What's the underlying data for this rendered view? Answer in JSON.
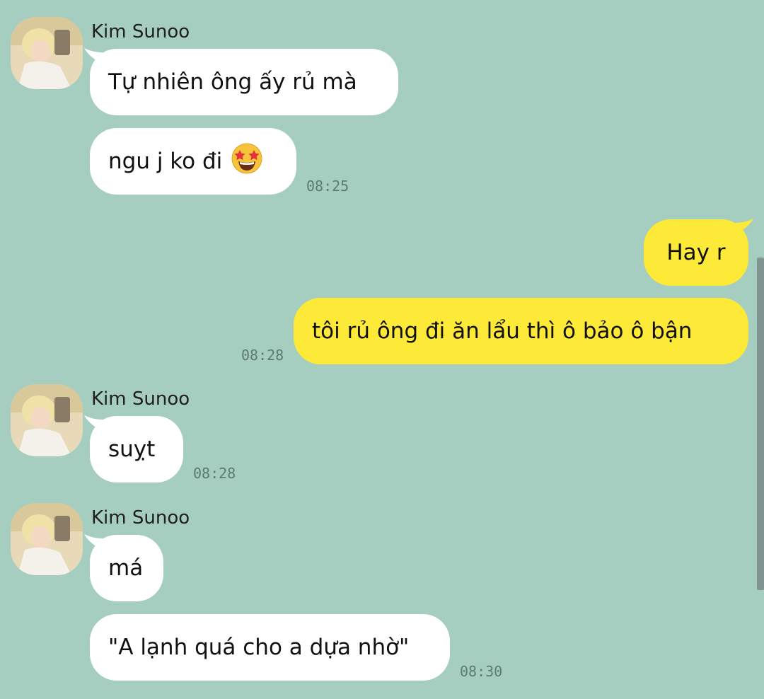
{
  "conversation": {
    "sender_name": "Kim Sunoo",
    "messages": [
      {
        "id": "m1",
        "direction": "in",
        "text": "Tự nhiên ông ấy rủ mà"
      },
      {
        "id": "m2",
        "direction": "in",
        "text": "ngu j ko đi",
        "emoji": "star-struck-emoji",
        "time": "08:25"
      },
      {
        "id": "m3",
        "direction": "out",
        "text": "Hay r"
      },
      {
        "id": "m4",
        "direction": "out",
        "text": "tôi rủ ông đi ăn lẩu thì ô bảo ô bận",
        "time": "08:28"
      },
      {
        "id": "m5",
        "direction": "in",
        "text": "suỵt",
        "time": "08:28"
      },
      {
        "id": "m6",
        "direction": "in",
        "text": "má"
      },
      {
        "id": "m7",
        "direction": "in",
        "text": "\"A lạnh quá cho a dựa nhờ\"",
        "time": "08:30"
      }
    ]
  },
  "colors": {
    "background": "#a5cdc0",
    "incoming_bubble": "#ffffff",
    "outgoing_bubble": "#fde937",
    "timestamp": "#5d7a72"
  }
}
